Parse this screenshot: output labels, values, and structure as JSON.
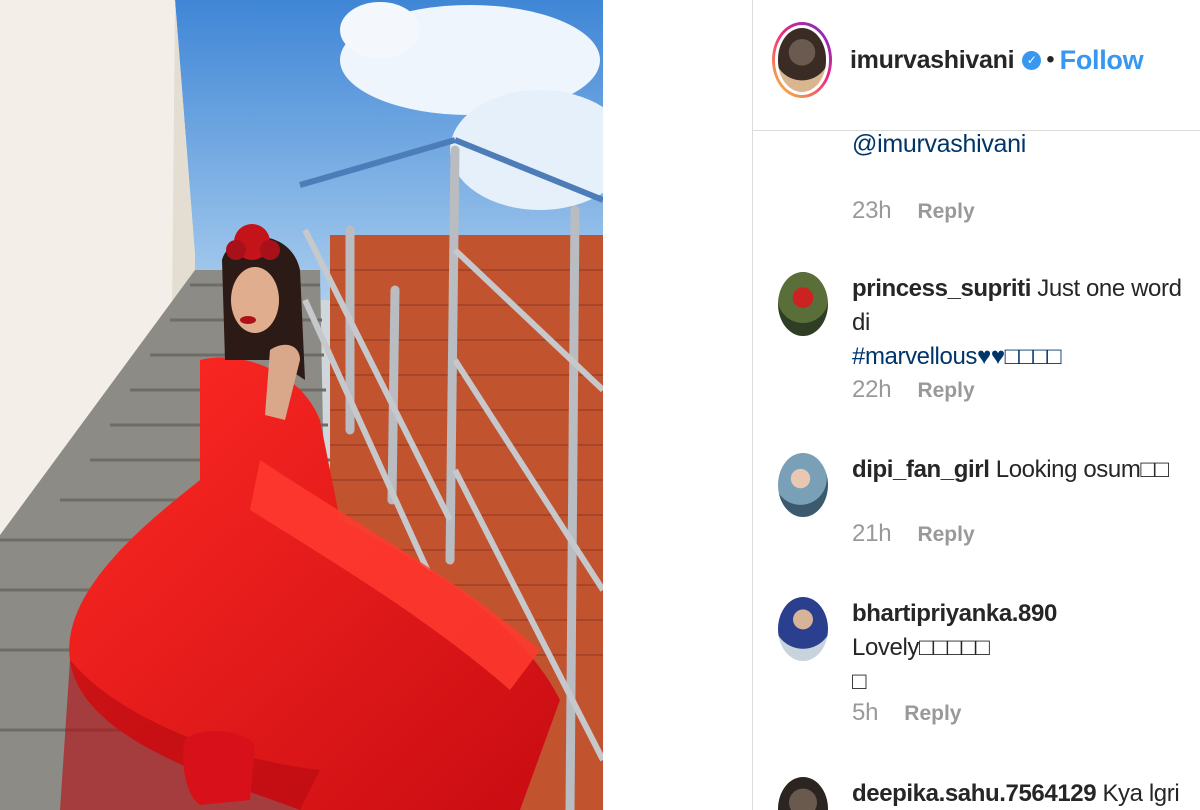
{
  "post": {
    "author": "imurvashivani",
    "verified_icon": "verified-badge-icon",
    "separator": "•",
    "follow_label": "Follow",
    "caption_tail": "@imurvashivani",
    "caption_time": "23h",
    "reply_label": "Reply"
  },
  "comments": [
    {
      "user": "princess_supriti",
      "text": "Just one word di",
      "line2": "#marvellous♥♥□□□□",
      "time": "22h"
    },
    {
      "user": "dipi_fan_girl",
      "text": "Looking osum□□",
      "line2": "",
      "time": "21h"
    },
    {
      "user": "bhartipriyanka.890",
      "text": "Lovely□□□□□",
      "line2": "□",
      "time": "5h"
    },
    {
      "user": "deepika.sahu.7564129",
      "text": "Kya lgri ho",
      "line2": "",
      "time": ""
    }
  ],
  "colors": {
    "accent": "#3897f0",
    "hashtag": "#003569",
    "muted": "#999999",
    "dress": "#e0141c"
  }
}
